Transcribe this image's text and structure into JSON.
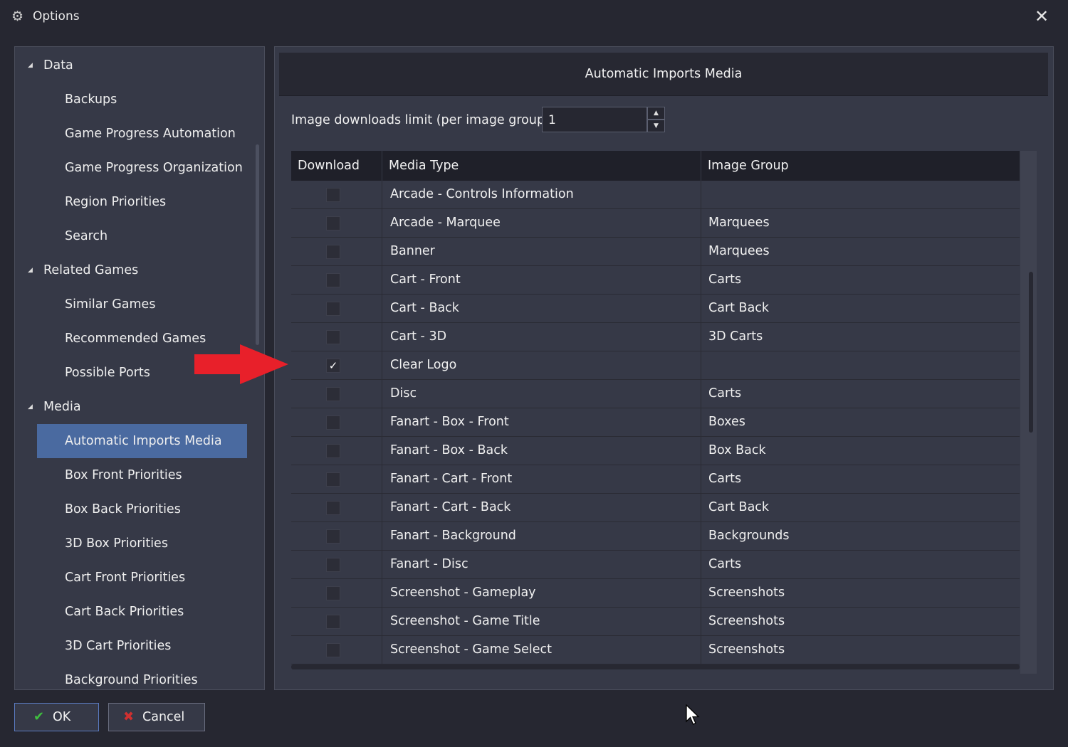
{
  "window": {
    "title": "Options",
    "close_glyph": "✕",
    "icon": "gear-icon"
  },
  "sidebar": {
    "selected": "Automatic Imports Media",
    "items": [
      {
        "label": "Data",
        "level": 0,
        "expanded": true
      },
      {
        "label": "Backups",
        "level": 1
      },
      {
        "label": "Game Progress Automation",
        "level": 1
      },
      {
        "label": "Game Progress Organization",
        "level": 1
      },
      {
        "label": "Region Priorities",
        "level": 1
      },
      {
        "label": "Search",
        "level": 1
      },
      {
        "label": "Related Games",
        "level": 0,
        "expanded": true
      },
      {
        "label": "Similar Games",
        "level": 1
      },
      {
        "label": "Recommended Games",
        "level": 1
      },
      {
        "label": "Possible Ports",
        "level": 1
      },
      {
        "label": "Media",
        "level": 0,
        "expanded": true
      },
      {
        "label": "Automatic Imports Media",
        "level": 1,
        "selected": true
      },
      {
        "label": "Box Front Priorities",
        "level": 1
      },
      {
        "label": "Box Back Priorities",
        "level": 1
      },
      {
        "label": "3D Box Priorities",
        "level": 1
      },
      {
        "label": "Cart Front Priorities",
        "level": 1
      },
      {
        "label": "Cart Back Priorities",
        "level": 1
      },
      {
        "label": "3D Cart Priorities",
        "level": 1
      },
      {
        "label": "Background Priorities",
        "level": 1
      }
    ]
  },
  "content": {
    "title": "Automatic Imports Media",
    "limit": {
      "label": "Image downloads limit (per image group):",
      "value": "1"
    },
    "table": {
      "columns": [
        "Download",
        "Media Type",
        "Image Group"
      ],
      "rows": [
        {
          "download": false,
          "media_type": "Arcade - Controls Information",
          "image_group": ""
        },
        {
          "download": false,
          "media_type": "Arcade - Marquee",
          "image_group": "Marquees"
        },
        {
          "download": false,
          "media_type": "Banner",
          "image_group": "Marquees"
        },
        {
          "download": false,
          "media_type": "Cart - Front",
          "image_group": "Carts"
        },
        {
          "download": false,
          "media_type": "Cart - Back",
          "image_group": "Cart Back"
        },
        {
          "download": false,
          "media_type": "Cart - 3D",
          "image_group": "3D Carts"
        },
        {
          "download": true,
          "media_type": "Clear Logo",
          "image_group": ""
        },
        {
          "download": false,
          "media_type": "Disc",
          "image_group": "Carts"
        },
        {
          "download": false,
          "media_type": "Fanart - Box - Front",
          "image_group": "Boxes"
        },
        {
          "download": false,
          "media_type": "Fanart - Box - Back",
          "image_group": "Box Back"
        },
        {
          "download": false,
          "media_type": "Fanart - Cart - Front",
          "image_group": "Carts"
        },
        {
          "download": false,
          "media_type": "Fanart - Cart - Back",
          "image_group": "Cart Back"
        },
        {
          "download": false,
          "media_type": "Fanart - Background",
          "image_group": "Backgrounds"
        },
        {
          "download": false,
          "media_type": "Fanart - Disc",
          "image_group": "Carts"
        },
        {
          "download": false,
          "media_type": "Screenshot - Gameplay",
          "image_group": "Screenshots"
        },
        {
          "download": false,
          "media_type": "Screenshot - Game Title",
          "image_group": "Screenshots"
        },
        {
          "download": false,
          "media_type": "Screenshot - Game Select",
          "image_group": "Screenshots"
        }
      ]
    }
  },
  "buttons": {
    "ok": {
      "label": "OK",
      "icon": "checkmark-icon",
      "icon_color": "#3fbf3f"
    },
    "cancel": {
      "label": "Cancel",
      "icon": "x-icon",
      "icon_color": "#d03030"
    }
  },
  "annotation": {
    "arrow_color": "#e8202a"
  }
}
